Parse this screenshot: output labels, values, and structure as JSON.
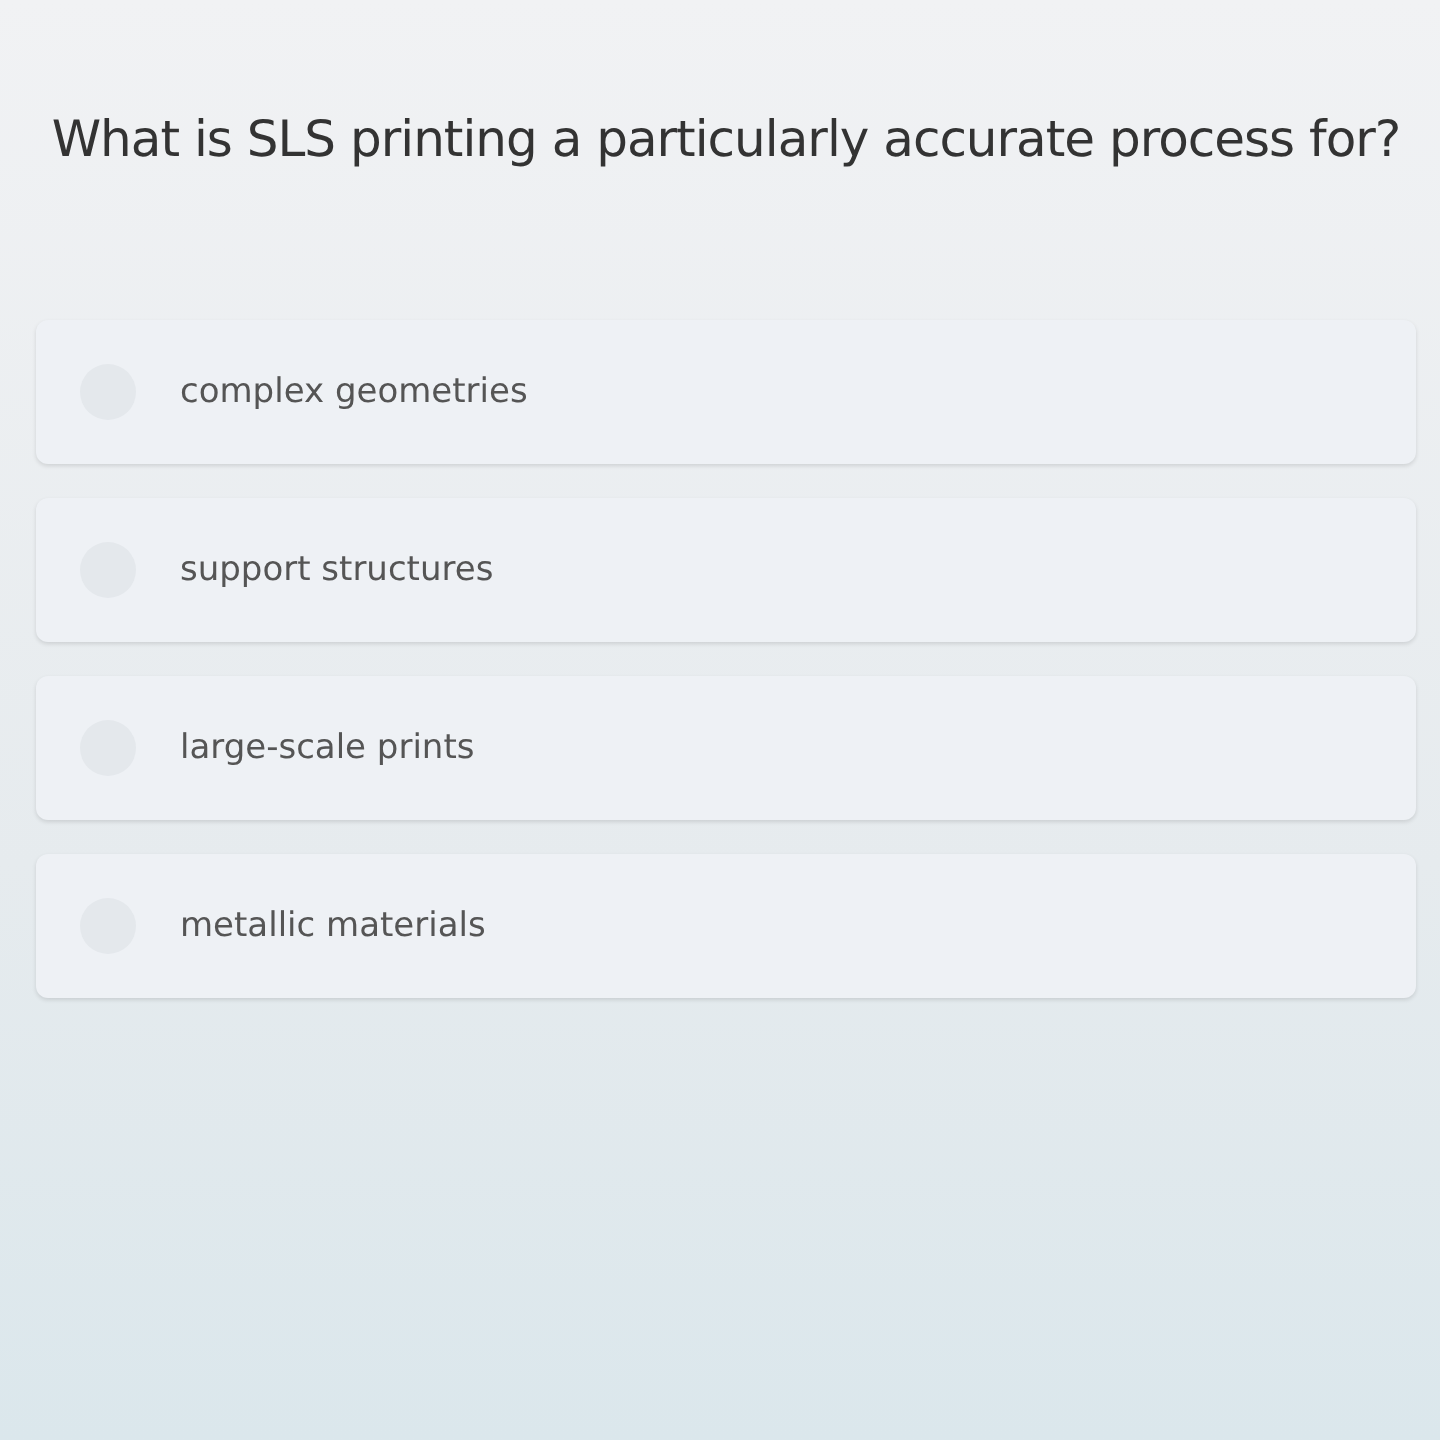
{
  "question": "What is SLS printing a particularly accurate process for?",
  "options": [
    {
      "label": "complex geometries",
      "selected": false
    },
    {
      "label": "support structures",
      "selected": false
    },
    {
      "label": "large-scale prints",
      "selected": false
    },
    {
      "label": "metallic materials",
      "selected": false
    }
  ]
}
